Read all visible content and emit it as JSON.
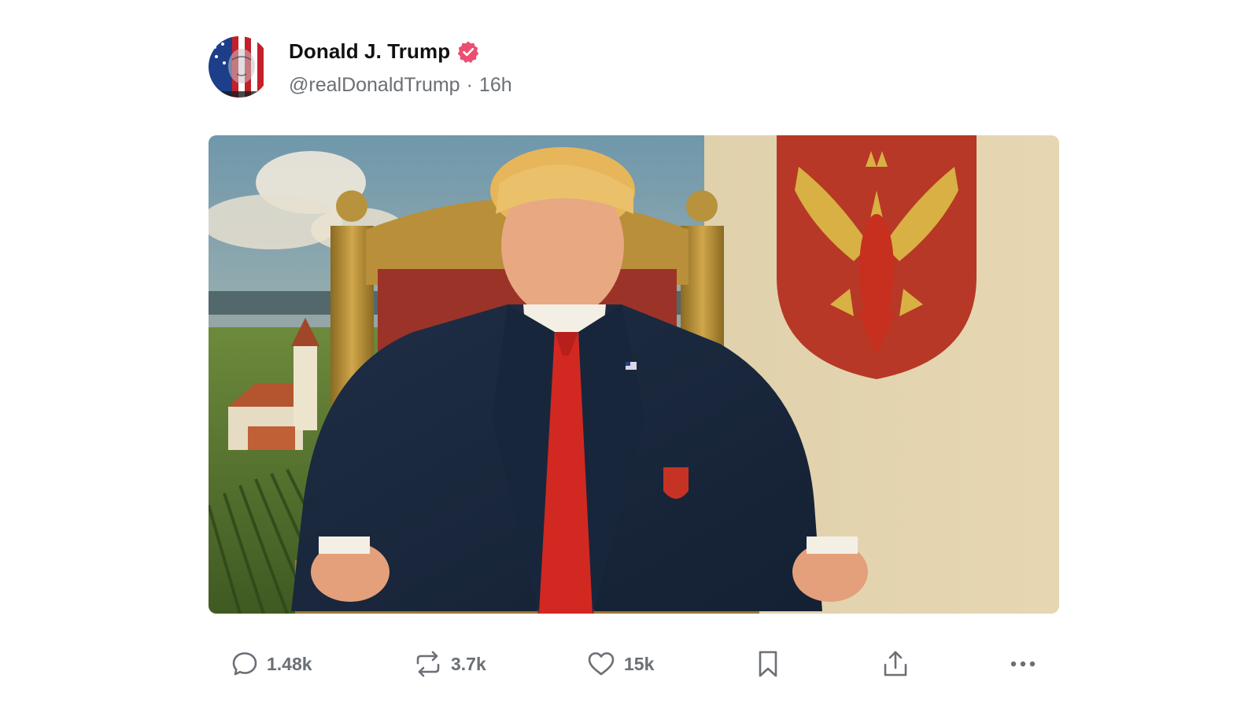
{
  "post": {
    "author": {
      "display_name": "Donald J. Trump",
      "handle": "@realDonaldTrump",
      "verified": true,
      "verified_color": "#ec4e72",
      "avatar_icon": "flag-portrait-avatar"
    },
    "separator": "·",
    "timestamp": "16h",
    "media": {
      "type": "painting",
      "icon": "portrait-throne-painting"
    },
    "actions": {
      "reply": {
        "icon": "reply-bubble-icon",
        "count": "1.48k"
      },
      "repost": {
        "icon": "repost-arrows-icon",
        "count": "3.7k"
      },
      "like": {
        "icon": "heart-icon",
        "count": "15k"
      },
      "bookmark": {
        "icon": "bookmark-icon"
      },
      "share": {
        "icon": "share-upload-icon"
      },
      "more": {
        "icon": "more-dots-icon"
      }
    }
  },
  "colors": {
    "text_primary": "#111111",
    "text_secondary": "#6b6f76",
    "background": "#ffffff"
  }
}
